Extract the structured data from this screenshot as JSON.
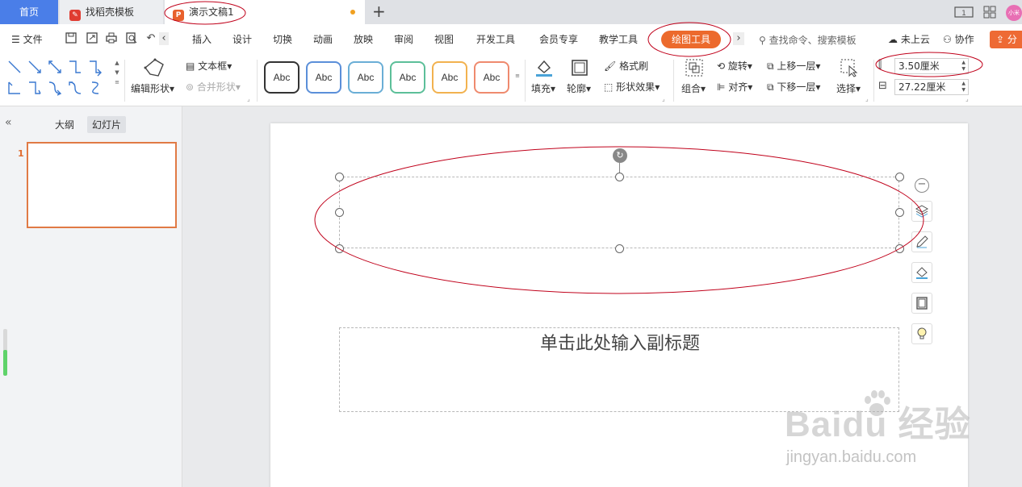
{
  "tabs": {
    "home": "首页",
    "template": "找稻壳模板",
    "document": "演示文稿1"
  },
  "titlebar": {
    "layout_icon": "layout-icon",
    "grid_icon": "grid-icon",
    "avatar_text": "小米"
  },
  "menu": {
    "file": "文件",
    "items": [
      "插入",
      "设计",
      "切换",
      "动画",
      "放映",
      "审阅",
      "视图",
      "开发工具",
      "会员专享",
      "教学工具"
    ],
    "active": "绘图工具",
    "search": "查找命令、搜索模板",
    "cloud": "未上云",
    "collab": "协作",
    "share": "分"
  },
  "ribbon": {
    "edit_shape": "编辑形状",
    "textbox": "文本框",
    "merge_shape": "合并形状",
    "style_label": "Abc",
    "style_colors": [
      "#333333",
      "#5b8fd9",
      "#6aaed6",
      "#5cbf99",
      "#f2b24f",
      "#ef8a6e"
    ],
    "fill": "填充",
    "outline": "轮廓",
    "format_painter": "格式刷",
    "shape_effect": "形状效果",
    "group": "组合",
    "rotate": "旋转",
    "align": "对齐",
    "bring_forward": "上移一层",
    "send_backward": "下移一层",
    "select": "选择",
    "height": "3.50厘米",
    "width": "27.22厘米"
  },
  "panel": {
    "outline_tab": "大纲",
    "slides_tab": "幻灯片",
    "slide_number": "1",
    "progress": 0.55
  },
  "slide": {
    "subtitle_placeholder": "单击此处输入副标题"
  },
  "watermark": {
    "main": "Baidu 经验",
    "sub": "jingyan.baidu.com"
  },
  "colors": {
    "accent": "#ec6a2c",
    "home_tab": "#4a7ee8",
    "annotation": "#c0001a"
  }
}
